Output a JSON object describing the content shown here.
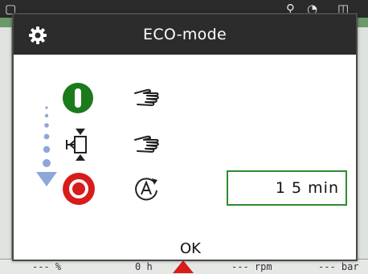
{
  "dialog": {
    "title": "ECO-mode",
    "time_field": {
      "value": "1 5 min"
    },
    "ok_label": "OK"
  },
  "background_status": {
    "percent": "--- %",
    "hours": "0 h",
    "rpm": "--- rpm",
    "bar": "--- bar"
  },
  "colors": {
    "header_bg": "#2c2c2c",
    "power_on_green": "#1b7a1b",
    "stop_red": "#d81b1b",
    "field_border": "#2e8b2e",
    "eco_scale_blue": "#8fa7d8"
  },
  "icons": {
    "gear": "gear-icon",
    "power_on": "power-on-icon",
    "valve": "valve-icon",
    "stop": "stop-icon",
    "hand": "hand-icon",
    "auto_restart": "auto-restart-icon",
    "eco_scale": "eco-scale-icon"
  }
}
